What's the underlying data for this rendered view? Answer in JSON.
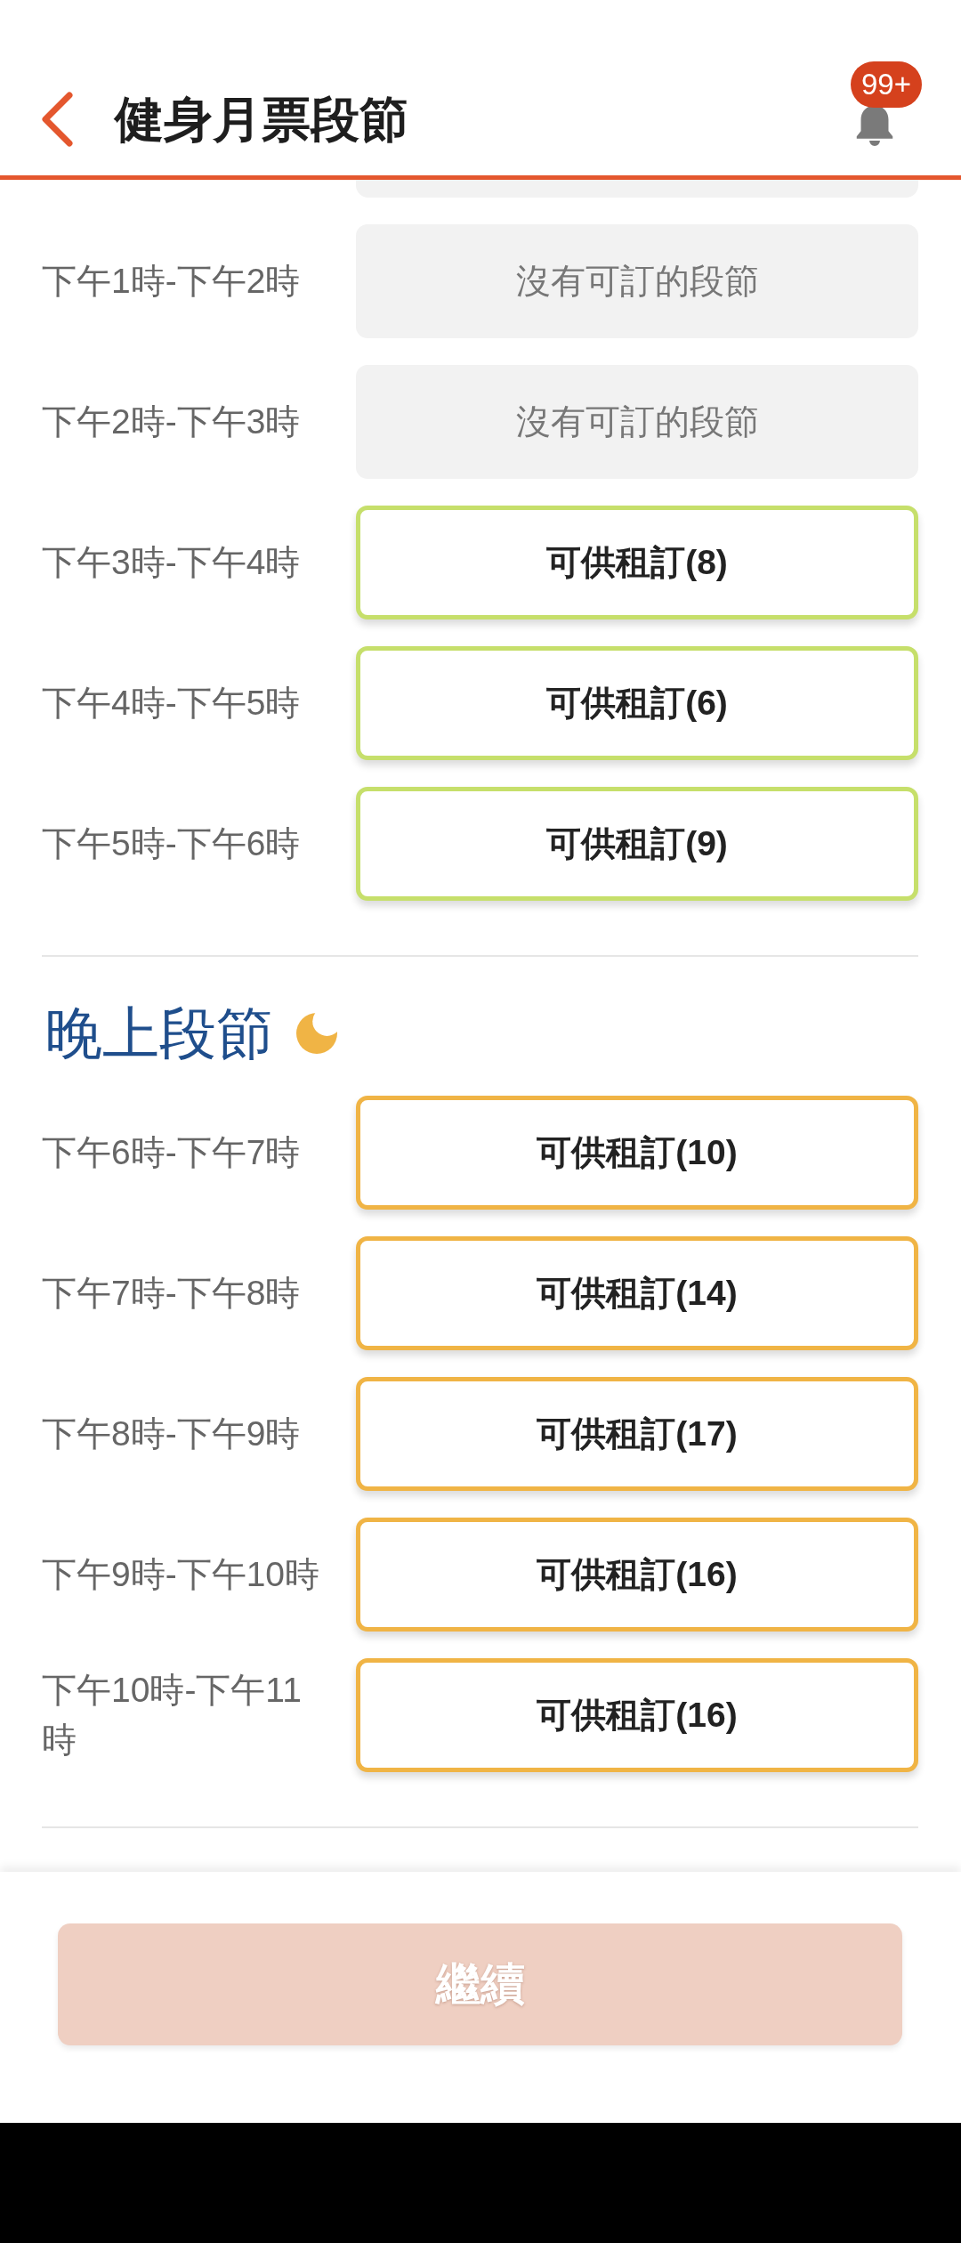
{
  "header": {
    "title": "健身月票段節",
    "notification_badge": "99+"
  },
  "partial_slot": {
    "available": false
  },
  "sections": [
    {
      "kind": "afternoon",
      "slots": [
        {
          "time": "下午1時-下午2時",
          "available": false,
          "text": "沒有可訂的段節"
        },
        {
          "time": "下午2時-下午3時",
          "available": false,
          "text": "沒有可訂的段節"
        },
        {
          "time": "下午3時-下午4時",
          "available": true,
          "text": "可供租訂(8)"
        },
        {
          "time": "下午4時-下午5時",
          "available": true,
          "text": "可供租訂(6)"
        },
        {
          "time": "下午5時-下午6時",
          "available": true,
          "text": "可供租訂(9)"
        }
      ]
    },
    {
      "kind": "evening",
      "title": "晚上段節",
      "slots": [
        {
          "time": "下午6時-下午7時",
          "available": true,
          "text": "可供租訂(10)"
        },
        {
          "time": "下午7時-下午8時",
          "available": true,
          "text": "可供租訂(14)"
        },
        {
          "time": "下午8時-下午9時",
          "available": true,
          "text": "可供租訂(17)"
        },
        {
          "time": "下午9時-下午10時",
          "available": true,
          "text": "可供租訂(16)"
        },
        {
          "time": "下午10時-下午11時",
          "available": true,
          "text": "可供租訂(16)"
        }
      ]
    }
  ],
  "footer": {
    "continue_button": {
      "label": "繼續",
      "disabled": true
    }
  }
}
